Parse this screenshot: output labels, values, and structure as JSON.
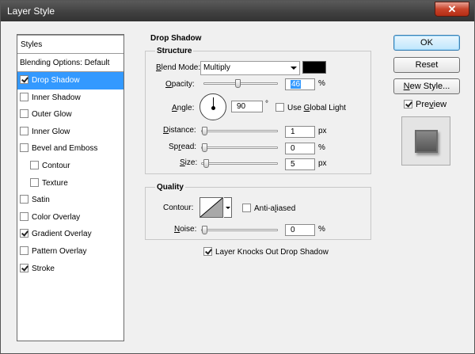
{
  "window": {
    "title": "Layer Style",
    "close_label": "✕"
  },
  "styles": {
    "header": "Styles",
    "blending": "Blending Options: Default",
    "items": [
      {
        "label": "Drop Shadow",
        "checked": true,
        "selected": true,
        "indent": false
      },
      {
        "label": "Inner Shadow",
        "checked": false,
        "selected": false,
        "indent": false
      },
      {
        "label": "Outer Glow",
        "checked": false,
        "selected": false,
        "indent": false
      },
      {
        "label": "Inner Glow",
        "checked": false,
        "selected": false,
        "indent": false
      },
      {
        "label": "Bevel and Emboss",
        "checked": false,
        "selected": false,
        "indent": false
      },
      {
        "label": "Contour",
        "checked": false,
        "selected": false,
        "indent": true
      },
      {
        "label": "Texture",
        "checked": false,
        "selected": false,
        "indent": true
      },
      {
        "label": "Satin",
        "checked": false,
        "selected": false,
        "indent": false
      },
      {
        "label": "Color Overlay",
        "checked": false,
        "selected": false,
        "indent": false
      },
      {
        "label": "Gradient Overlay",
        "checked": true,
        "selected": false,
        "indent": false
      },
      {
        "label": "Pattern Overlay",
        "checked": false,
        "selected": false,
        "indent": false
      },
      {
        "label": "Stroke",
        "checked": true,
        "selected": false,
        "indent": false
      }
    ]
  },
  "drop_shadow": {
    "title": "Drop Shadow",
    "structure": {
      "title": "Structure",
      "blend_mode": {
        "label": "Blend Mode:",
        "value": "Multiply",
        "color": "#000000"
      },
      "opacity": {
        "label": "Opacity:",
        "value": "46",
        "unit": "%",
        "fraction": 0.46
      },
      "angle": {
        "label": "Angle:",
        "value": "90",
        "unit": "°"
      },
      "global_light": {
        "label": "Use Global Light",
        "checked": false
      },
      "distance": {
        "label": "Distance:",
        "value": "1",
        "unit": "px",
        "fraction": 0.0
      },
      "spread": {
        "label": "Spread:",
        "value": "0",
        "unit": "%",
        "fraction": 0.0
      },
      "size": {
        "label": "Size:",
        "value": "5",
        "unit": "px",
        "fraction": 0.02
      }
    },
    "quality": {
      "title": "Quality",
      "contour": {
        "label": "Contour:"
      },
      "anti_aliased": {
        "label": "Anti-aliased",
        "checked": false
      },
      "noise": {
        "label": "Noise:",
        "value": "0",
        "unit": "%",
        "fraction": 0.0
      }
    },
    "knockout": {
      "label": "Layer Knocks Out Drop Shadow",
      "checked": true
    }
  },
  "buttons": {
    "ok": "OK",
    "reset": "Reset",
    "new_style": "New Style...",
    "preview": {
      "label": "Preview",
      "checked": true
    }
  }
}
